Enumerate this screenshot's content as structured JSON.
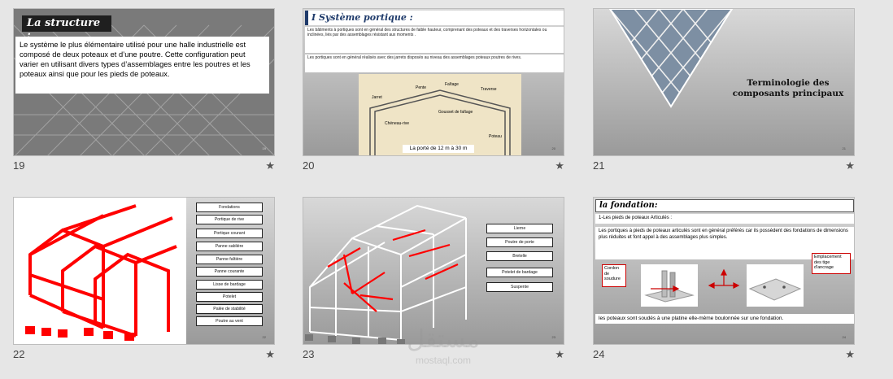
{
  "slides": [
    {
      "number": "19",
      "title": "La structure :",
      "body": "Le système le plus élémentaire utilisé pour une halle industrielle est composé de deux poteaux et d’une poutre. Cette configuration peut varier en utilisant divers types d’assemblages entre les poutres et les poteaux ainsi que pour les pieds de poteaux.",
      "page": "19"
    },
    {
      "number": "20",
      "title": "I Système portique :",
      "text1": "Les bâtiments à portiques sont en général des structures de faible hauteur, comprenant des poteaux et des traverses horizontales ou inclinées, liés par des assemblages résistant aux moments .",
      "text2": "Les portiques sont en général réalisés avec des jarrets disposés au niveau des assemblages poteaux poutres de rives.",
      "labels": [
        "Pente",
        "Faîtage",
        "Traverse",
        "Jarret",
        "Gousset de faîtage",
        "Chéneau-rive",
        "Poteau"
      ],
      "span": "La porté de 12 m à 30 m",
      "page": "20"
    },
    {
      "number": "21",
      "title": "Terminologie des composants principaux",
      "page": "21"
    },
    {
      "number": "22",
      "labels": [
        "Fondations",
        "Portique de rive",
        "Portique courant",
        "Panne sablière",
        "Panne faîtière",
        "Panne courante",
        "Lisse de bardage",
        "Potelet",
        "Palée de stabilité",
        "Poutre au vent"
      ],
      "page": "22"
    },
    {
      "number": "23",
      "labels": [
        "Lierne",
        "Poutre de porte",
        "Bretelle",
        "Potelet de bardage",
        "Suspente"
      ],
      "page": "23"
    },
    {
      "number": "24",
      "title": "la  fondation:",
      "subtitle": "1-Les pieds de poteaux Articulés :",
      "para": "Les portiques à pieds de poteaux articulés sont en général préférés car ils possèdent des fondations de dimensions plus réduites et font appel à des assemblages plus simples.",
      "label_left": "Cordon de soudure",
      "label_right": "Emplacement des tige d'ancrage",
      "footer": "les poteaux sont soudés à une platine elle-même boulonnée sur une fondation.",
      "page": "24"
    }
  ],
  "watermark": {
    "arabic": "مستقل",
    "latin": "mostaql.com"
  },
  "colors": {
    "red": "#ff0000",
    "navy": "#1f3b6b",
    "beige": "#efe4c6"
  }
}
